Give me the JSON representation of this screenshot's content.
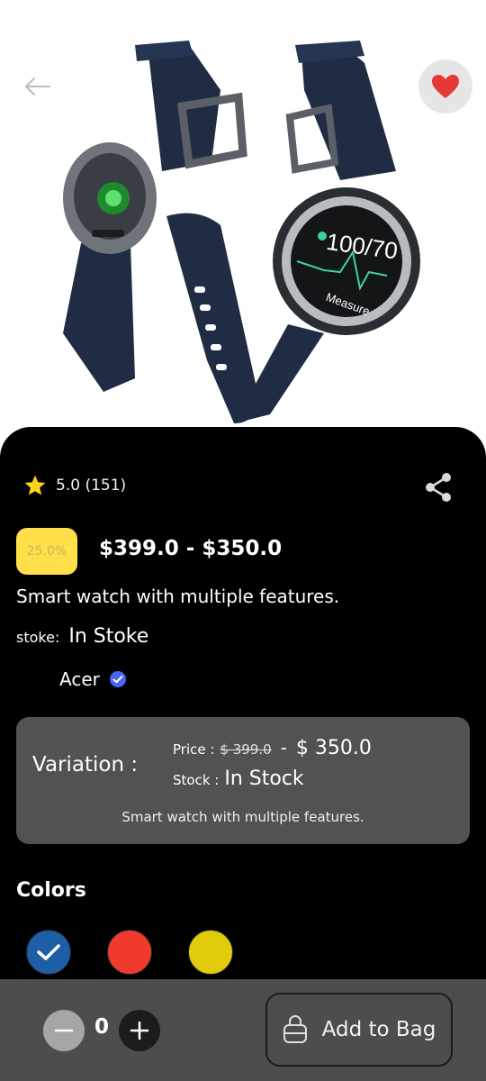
{
  "header": {
    "back_icon": "arrow-left-icon",
    "favorite_icon": "heart-icon"
  },
  "product": {
    "image_alt": "smart-watch-image",
    "rating": "5.0 (151)",
    "discount": "25.0%",
    "price_range": "$399.0 - $350.0",
    "description": "Smart watch with multiple features.",
    "stock_label": "stoke:",
    "stock_value": "In Stoke",
    "brand": "Acer",
    "watch_screen_reading": "100/70",
    "watch_screen_label": "Measure"
  },
  "variation": {
    "title": "Variation :",
    "price_label": "Price :",
    "old_price": "$ 399.0",
    "separator": "-",
    "new_price": "$ 350.0",
    "stock_label": "Stock :",
    "stock_value": "In Stock",
    "description": "Smart watch with multiple features."
  },
  "colors": {
    "title": "Colors",
    "options": [
      {
        "color": "#1e5ea6",
        "selected": true
      },
      {
        "color": "#f03a2e",
        "selected": false
      },
      {
        "color": "#e0cc0a",
        "selected": false
      }
    ]
  },
  "cart": {
    "quantity": "0",
    "add_label": "Add to Bag"
  },
  "colors_theme": {
    "sheet": "#000000",
    "card": "#525252",
    "badge": "#ffe04a",
    "favorite": "#e53935",
    "star": "#ffd21f",
    "verified": "#4a66f0"
  }
}
